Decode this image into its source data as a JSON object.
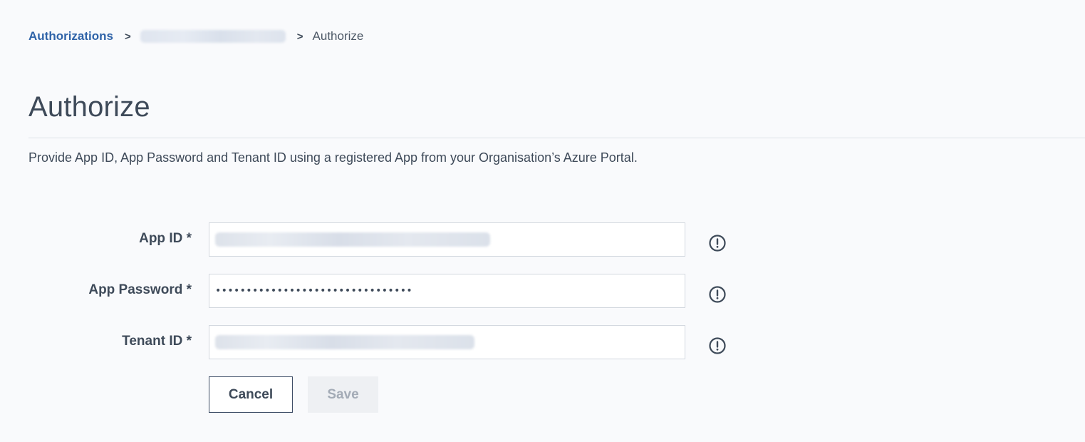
{
  "breadcrumb": {
    "root": "Authorizations",
    "separator": ">",
    "current": "Authorize"
  },
  "page": {
    "title": "Authorize",
    "description": "Provide App ID, App Password and Tenant ID using a registered App from your Organisation’s Azure Portal."
  },
  "form": {
    "app_id": {
      "label": "App ID *"
    },
    "app_password": {
      "label": "App Password *",
      "value": "••••••••••••••••••••••••••••••••"
    },
    "tenant_id": {
      "label": "Tenant ID *"
    }
  },
  "actions": {
    "cancel_label": "Cancel",
    "save_label": "Save"
  },
  "icons": {
    "info": "info-circle-icon"
  },
  "colors": {
    "link": "#2f63a8",
    "text": "#3e4a59",
    "background": "#f9fafc",
    "button_border": "#3d4d66",
    "disabled_text": "#a3abb6"
  }
}
